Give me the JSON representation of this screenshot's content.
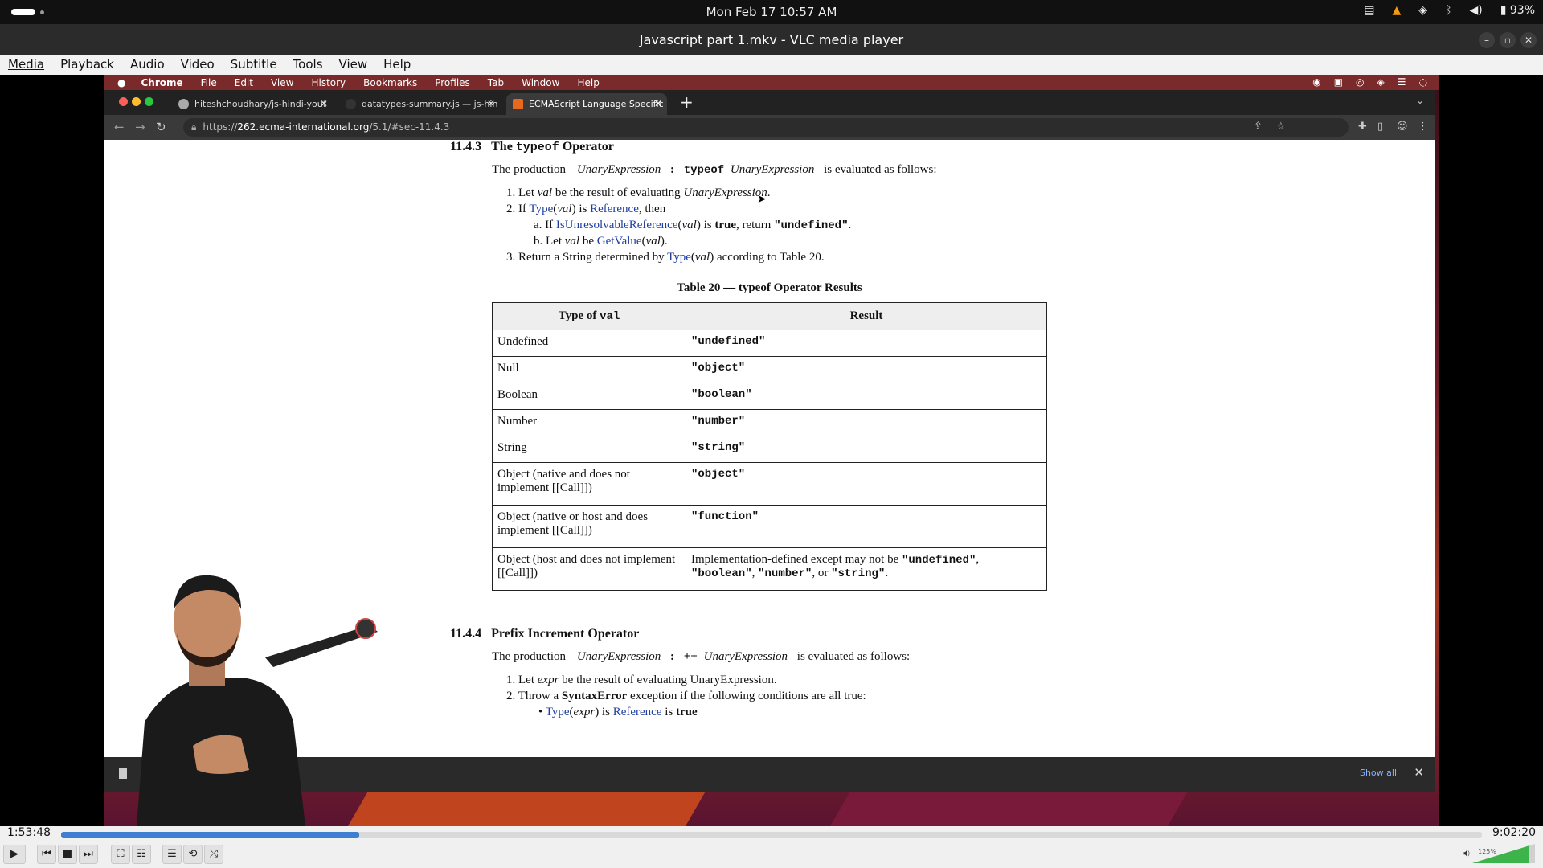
{
  "topbar": {
    "clock": "Mon Feb 17  10:57 AM",
    "battery": "93%"
  },
  "window": {
    "title": "Javascript part 1.mkv - VLC media player",
    "menu": [
      "Media",
      "Playback",
      "Audio",
      "Video",
      "Subtitle",
      "Tools",
      "View",
      "Help"
    ]
  },
  "mac_menu": [
    "Chrome",
    "File",
    "Edit",
    "View",
    "History",
    "Bookmarks",
    "Profiles",
    "Tab",
    "Window",
    "Help"
  ],
  "browser": {
    "tabs": [
      {
        "label": "hiteshchoudhary/js-hindi-yout",
        "active": false
      },
      {
        "label": "datatypes-summary.js — js-hin",
        "active": false
      },
      {
        "label": "ECMAScript Language Specific",
        "active": true
      }
    ],
    "url_prefix": "https://",
    "url_host": "262.ecma-international.org",
    "url_path": "/5.1/#sec-11.4.3",
    "download_bar": {
      "show_all": "Show all"
    }
  },
  "doc": {
    "sec1_num": "11.4.3",
    "sec1_title_pre": "The ",
    "sec1_title_code": "typeof",
    "sec1_title_post": " Operator",
    "sec1_prod_pre": "The production",
    "sec1_prod_lhs": "UnaryExpression",
    "sec1_prod_colon": ":",
    "sec1_prod_kw": "typeof",
    "sec1_prod_rhs": "UnaryExpression",
    "sec1_prod_post": "is evaluated as follows:",
    "steps": {
      "s1_a": "1. Let ",
      "s1_b": "val",
      "s1_c": " be the result of evaluating ",
      "s1_d": "UnaryExpression",
      "s1_e": ".",
      "s2_a": "2. If ",
      "s2_type": "Type",
      "s2_b": "(",
      "s2_val": "val",
      "s2_c": ") is ",
      "s2_ref": "Reference",
      "s2_d": ", then",
      "sa_a": "a. If ",
      "sa_fn": "IsUnresolvableReference",
      "sa_b": "(",
      "sa_val": "val",
      "sa_c": ") is ",
      "sa_true": "true",
      "sa_d": ", return ",
      "sa_code": "\"undefined\"",
      "sa_e": ".",
      "sb_a": "b. Let ",
      "sb_val": "val",
      "sb_b": " be ",
      "sb_fn": "GetValue",
      "sb_c": "(",
      "sb_val2": "val",
      "sb_d": ").",
      "s3_a": "3. Return a String determined by ",
      "s3_type": "Type",
      "s3_b": "(",
      "s3_val": "val",
      "s3_c": ") according to Table 20."
    },
    "table_caption": "Table 20 — typeof Operator Results",
    "table_head_1a": "Type of ",
    "table_head_1b": "val",
    "table_head_2": "Result",
    "rows": [
      {
        "type": "Undefined",
        "result": "\"undefined\""
      },
      {
        "type": "Null",
        "result": "\"object\""
      },
      {
        "type": "Boolean",
        "result": "\"boolean\""
      },
      {
        "type": "Number",
        "result": "\"number\""
      },
      {
        "type": "String",
        "result": "\"string\""
      },
      {
        "type": "Object (native and does not implement [[Call]])",
        "result": "\"object\""
      },
      {
        "type": "Object (native or host and does implement [[Call]])",
        "result": "\"function\""
      }
    ],
    "last_row_type": "Object (host and does not implement [[Call]])",
    "last_row_a": "Implementation-defined except may not be ",
    "last_row_c1": "\"undefined\"",
    "last_row_b": ",",
    "last_row_c2": "\"boolean\"",
    "last_row_c": ", ",
    "last_row_c3": "\"number\"",
    "last_row_d": ", or ",
    "last_row_c4": "\"string\"",
    "last_row_e": ".",
    "sec2_num": "11.4.4",
    "sec2_title": "Prefix Increment Operator",
    "sec2_prod_pre": "The production",
    "sec2_prod_lhs": "UnaryExpression",
    "sec2_prod_colon": ":",
    "sec2_prod_kw": "++",
    "sec2_prod_rhs": "UnaryExpression",
    "sec2_prod_post": "is evaluated as follows:",
    "sec2_s1_a": "1. Let ",
    "sec2_s1_b": "expr",
    "sec2_s1_c": " be the result of evaluating UnaryExpression.",
    "sec2_s2_a": "2. Throw a ",
    "sec2_s2_b": "SyntaxError",
    "sec2_s2_c": " exception if the following conditions are all true:",
    "sec2_b1_dot": "•",
    "sec2_b1_type": "Type",
    "sec2_b1_a": "(",
    "sec2_b1_expr": "expr",
    "sec2_b1_b": ") is ",
    "sec2_b1_ref": "Reference",
    "sec2_b1_c": " is ",
    "sec2_b1_true": "true"
  },
  "player": {
    "current_time": "1:53:48",
    "total_time": "9:02:20",
    "progress": 0.21,
    "volume_label": "125%",
    "volume": 0.9
  },
  "colors": {
    "seek": "#3e7fd1",
    "link": "#1f3fa0",
    "volume": "#3cb44b"
  }
}
